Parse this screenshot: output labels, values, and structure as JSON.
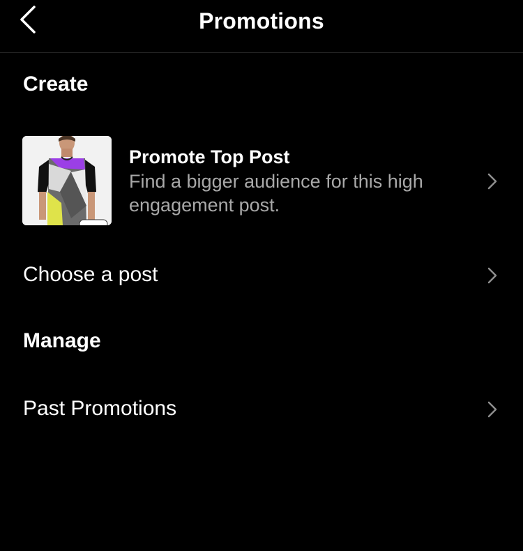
{
  "header": {
    "title": "Promotions",
    "back_icon": "chevron-left-icon"
  },
  "create": {
    "heading": "Create",
    "top_post": {
      "title": "Promote Top Post",
      "description": "Find a bigger audience for this high engagement post.",
      "thumbnail": "tshirt-post-image",
      "chevron_icon": "chevron-right-icon"
    },
    "choose_post": {
      "label": "Choose a post",
      "chevron_icon": "chevron-right-icon"
    }
  },
  "manage": {
    "heading": "Manage",
    "past_promotions": {
      "label": "Past Promotions",
      "chevron_icon": "chevron-right-icon"
    }
  },
  "colors": {
    "background": "#000000",
    "text_primary": "#ffffff",
    "text_secondary": "#a8a8a8",
    "divider": "#262626",
    "chevron": "#8e8e8e",
    "shirt_purple": "#9b3fe6",
    "shirt_yellow": "#dfe34a",
    "shirt_gray": "#6b6b6b"
  }
}
